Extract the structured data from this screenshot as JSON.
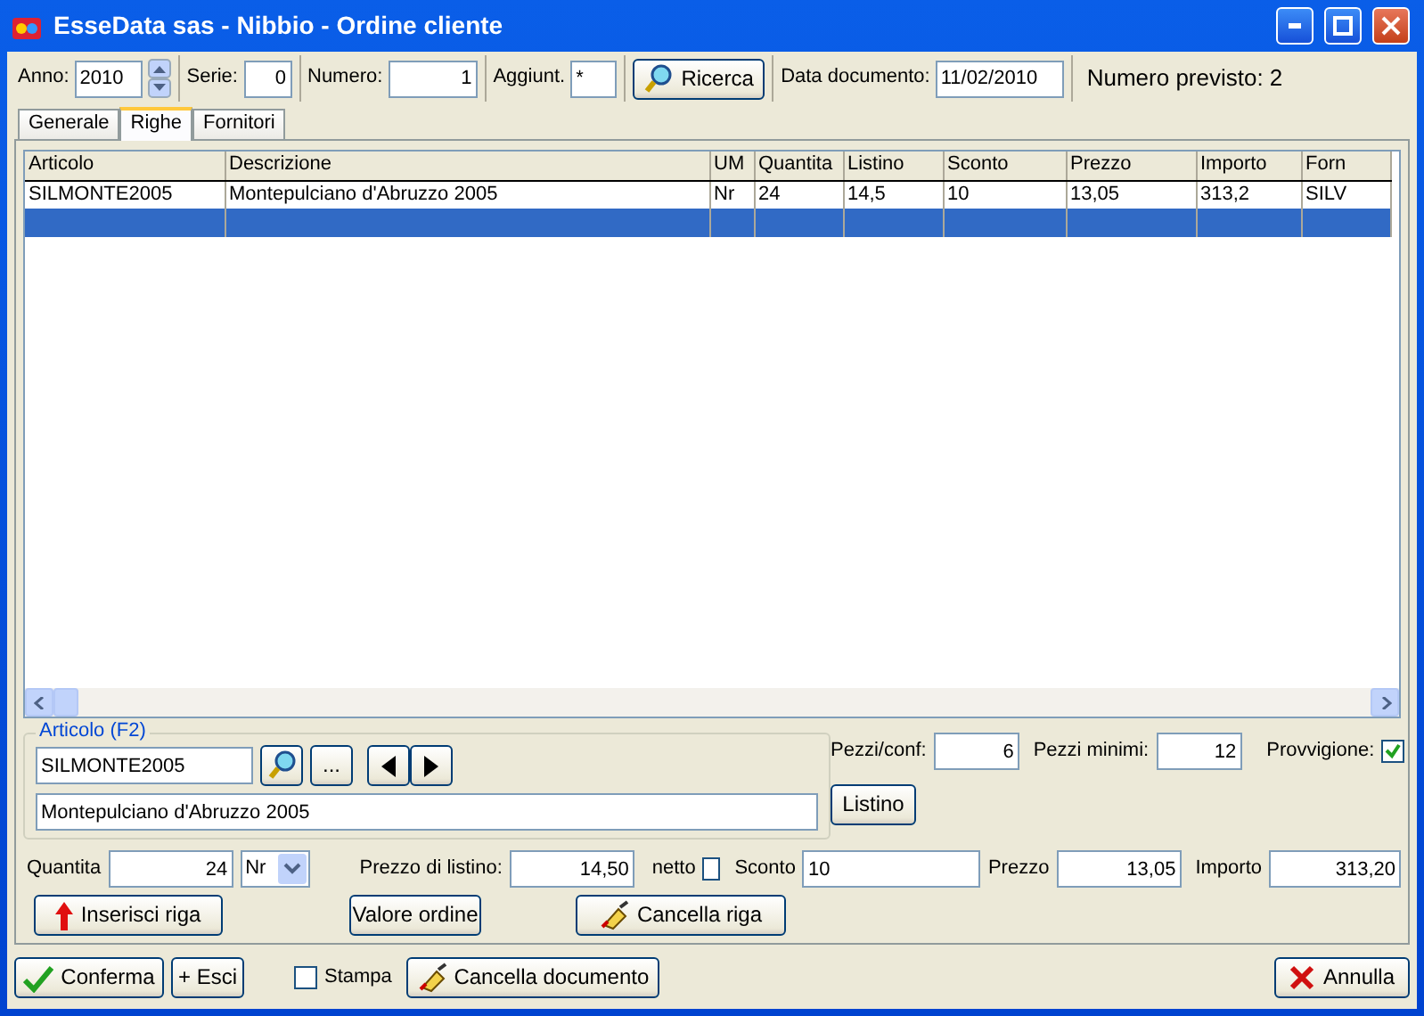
{
  "window": {
    "title": "EsseData sas - Nibbio - Ordine cliente"
  },
  "header": {
    "anno_label": "Anno:",
    "anno": "2010",
    "serie_label": "Serie:",
    "serie": "0",
    "numero_label": "Numero:",
    "numero": "1",
    "aggiunt_label": "Aggiunt.",
    "aggiunt": "*",
    "search_button": "Ricerca",
    "data_label": "Data documento:",
    "data": "11/02/2010",
    "numero_previsto": "Numero previsto: 2"
  },
  "tabs": [
    {
      "label": "Generale",
      "selected": false
    },
    {
      "label": "Righe",
      "selected": true
    },
    {
      "label": "Fornitori",
      "selected": false
    }
  ],
  "grid": {
    "columns": [
      "Articolo",
      "Descrizione",
      "UM",
      "Quantita",
      "Listino",
      "Sconto",
      "Prezzo",
      "Importo",
      "Forn"
    ],
    "rows": [
      {
        "cells": [
          "SILMONTE2005",
          "Montepulciano d'Abruzzo 2005",
          "Nr",
          "24",
          "14,5",
          "10",
          "13,05",
          "313,2",
          "SILV"
        ],
        "selected": false
      },
      {
        "selected": true
      }
    ]
  },
  "article": {
    "legend": "Articolo (F2)",
    "code": "SILMONTE2005",
    "browse_button": "...",
    "description": "Montepulciano d'Abruzzo 2005"
  },
  "pack": {
    "pezzi_conf_label": "Pezzi/conf:",
    "pezzi_conf": "6",
    "pezzi_minimi_label": "Pezzi minimi:",
    "pezzi_minimi": "12",
    "provvigione_label": "Provvigione:",
    "provvigione_checked": true,
    "listino_button": "Listino"
  },
  "line": {
    "quantita_label": "Quantita",
    "quantita": "24",
    "um": "Nr",
    "prezzo_listino_label": "Prezzo di listino:",
    "prezzo_listino": "14,50",
    "netto_label": "netto",
    "netto_checked": false,
    "sconto_label": "Sconto",
    "sconto": "10",
    "prezzo_label": "Prezzo",
    "prezzo": "13,05",
    "importo_label": "Importo",
    "importo": "313,20"
  },
  "line_buttons": {
    "insert": "Inserisci riga",
    "order_value": "Valore ordine",
    "delete": "Cancella riga"
  },
  "footer": {
    "confirm": "Conferma",
    "exit": "+ Esci",
    "print_label": "Stampa",
    "print_checked": false,
    "delete_document": "Cancella documento",
    "cancel": "Annulla"
  }
}
